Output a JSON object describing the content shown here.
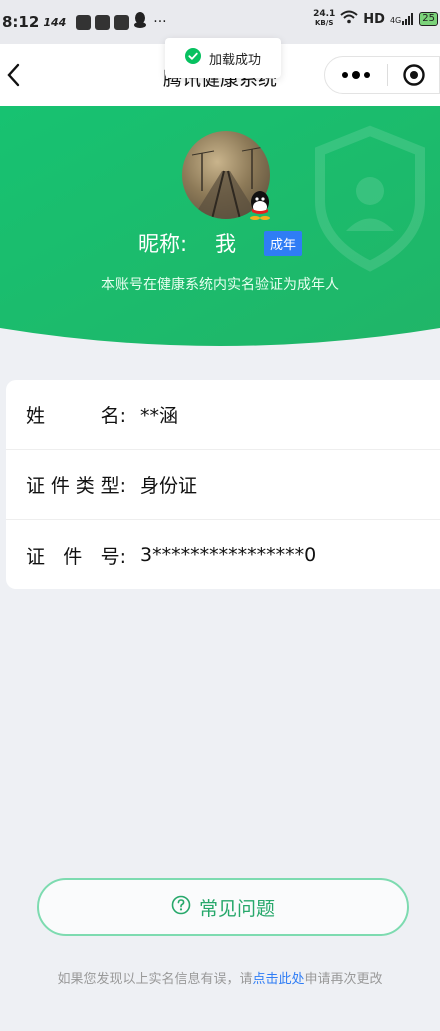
{
  "status_bar": {
    "time": "8:12",
    "speed_small": "144",
    "net_speed_value": "24.1",
    "net_speed_unit": "KB/S",
    "hd": "HD",
    "signal": "4G",
    "battery": "25"
  },
  "nav": {
    "title": "腾讯健康系统"
  },
  "toast": {
    "text": "加载成功"
  },
  "profile": {
    "nick_label": "昵称:",
    "nick_value": "我",
    "badge": "成年",
    "subtitle": "本账号在健康系统内实名验证为成年人"
  },
  "info": {
    "rows": [
      {
        "label": "姓名:",
        "value": "**涵"
      },
      {
        "label": "证件类型:",
        "value": "身份证"
      },
      {
        "label": "证件号:",
        "value": "3****************0"
      }
    ]
  },
  "faq": {
    "label": "常见问题"
  },
  "footer": {
    "before": "如果您发现以上实名信息有误，请",
    "link": "点击此处",
    "after": "申请再次更改"
  },
  "colors": {
    "brand_green": "#1fc070",
    "badge_blue": "#2f7df5"
  }
}
